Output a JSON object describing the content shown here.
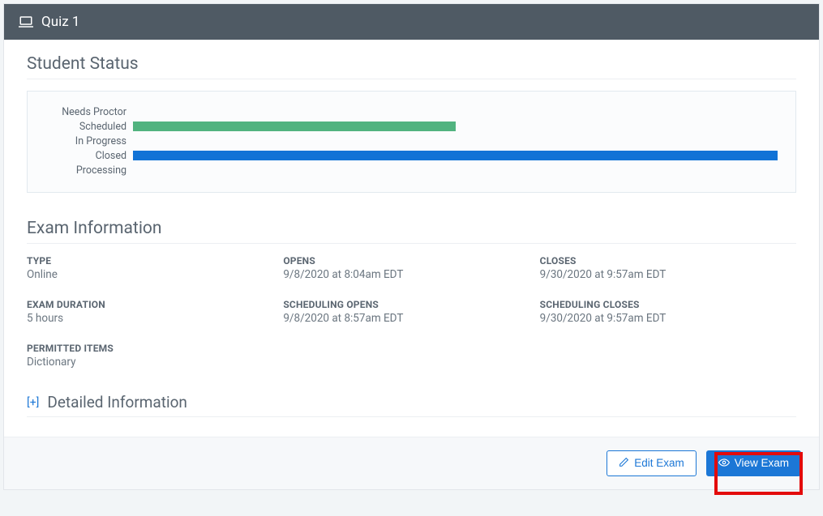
{
  "header": {
    "title": "Quiz 1"
  },
  "student_status": {
    "title": "Student Status",
    "rows": [
      {
        "label": "Needs Proctor",
        "width_pct": 0,
        "color": "#51b37f"
      },
      {
        "label": "Scheduled",
        "width_pct": 50,
        "color": "#51b37f"
      },
      {
        "label": "In Progress",
        "width_pct": 0,
        "color": "#51b37f"
      },
      {
        "label": "Closed",
        "width_pct": 100,
        "color": "#1273d6"
      },
      {
        "label": "Processing",
        "width_pct": 0,
        "color": "#51b37f"
      }
    ]
  },
  "exam_info": {
    "title": "Exam Information",
    "type_label": "TYPE",
    "type_value": "Online",
    "opens_label": "OPENS",
    "opens_value": "9/8/2020 at 8:04am EDT",
    "closes_label": "CLOSES",
    "closes_value": "9/30/2020 at 9:57am EDT",
    "duration_label": "EXAM DURATION",
    "duration_value": "5 hours",
    "sched_opens_label": "SCHEDULING OPENS",
    "sched_opens_value": "9/8/2020 at 8:57am EDT",
    "sched_closes_label": "SCHEDULING CLOSES",
    "sched_closes_value": "9/30/2020 at 9:57am EDT",
    "permitted_label": "PERMITTED ITEMS",
    "permitted_value": "Dictionary"
  },
  "detailed": {
    "expand_symbol": "[+]",
    "title": "Detailed Information"
  },
  "footer": {
    "edit_label": "Edit Exam",
    "view_label": "View Exam"
  },
  "chart_data": {
    "type": "bar",
    "orientation": "horizontal",
    "title": "Student Status",
    "categories": [
      "Needs Proctor",
      "Scheduled",
      "In Progress",
      "Closed",
      "Processing"
    ],
    "values_pct_of_max": [
      0,
      50,
      0,
      100,
      0
    ],
    "colors": [
      "#51b37f",
      "#51b37f",
      "#51b37f",
      "#1273d6",
      "#51b37f"
    ],
    "note": "Bar lengths are relative to the longest bar (Closed = 100%); numeric counts are not labeled in the source image."
  }
}
